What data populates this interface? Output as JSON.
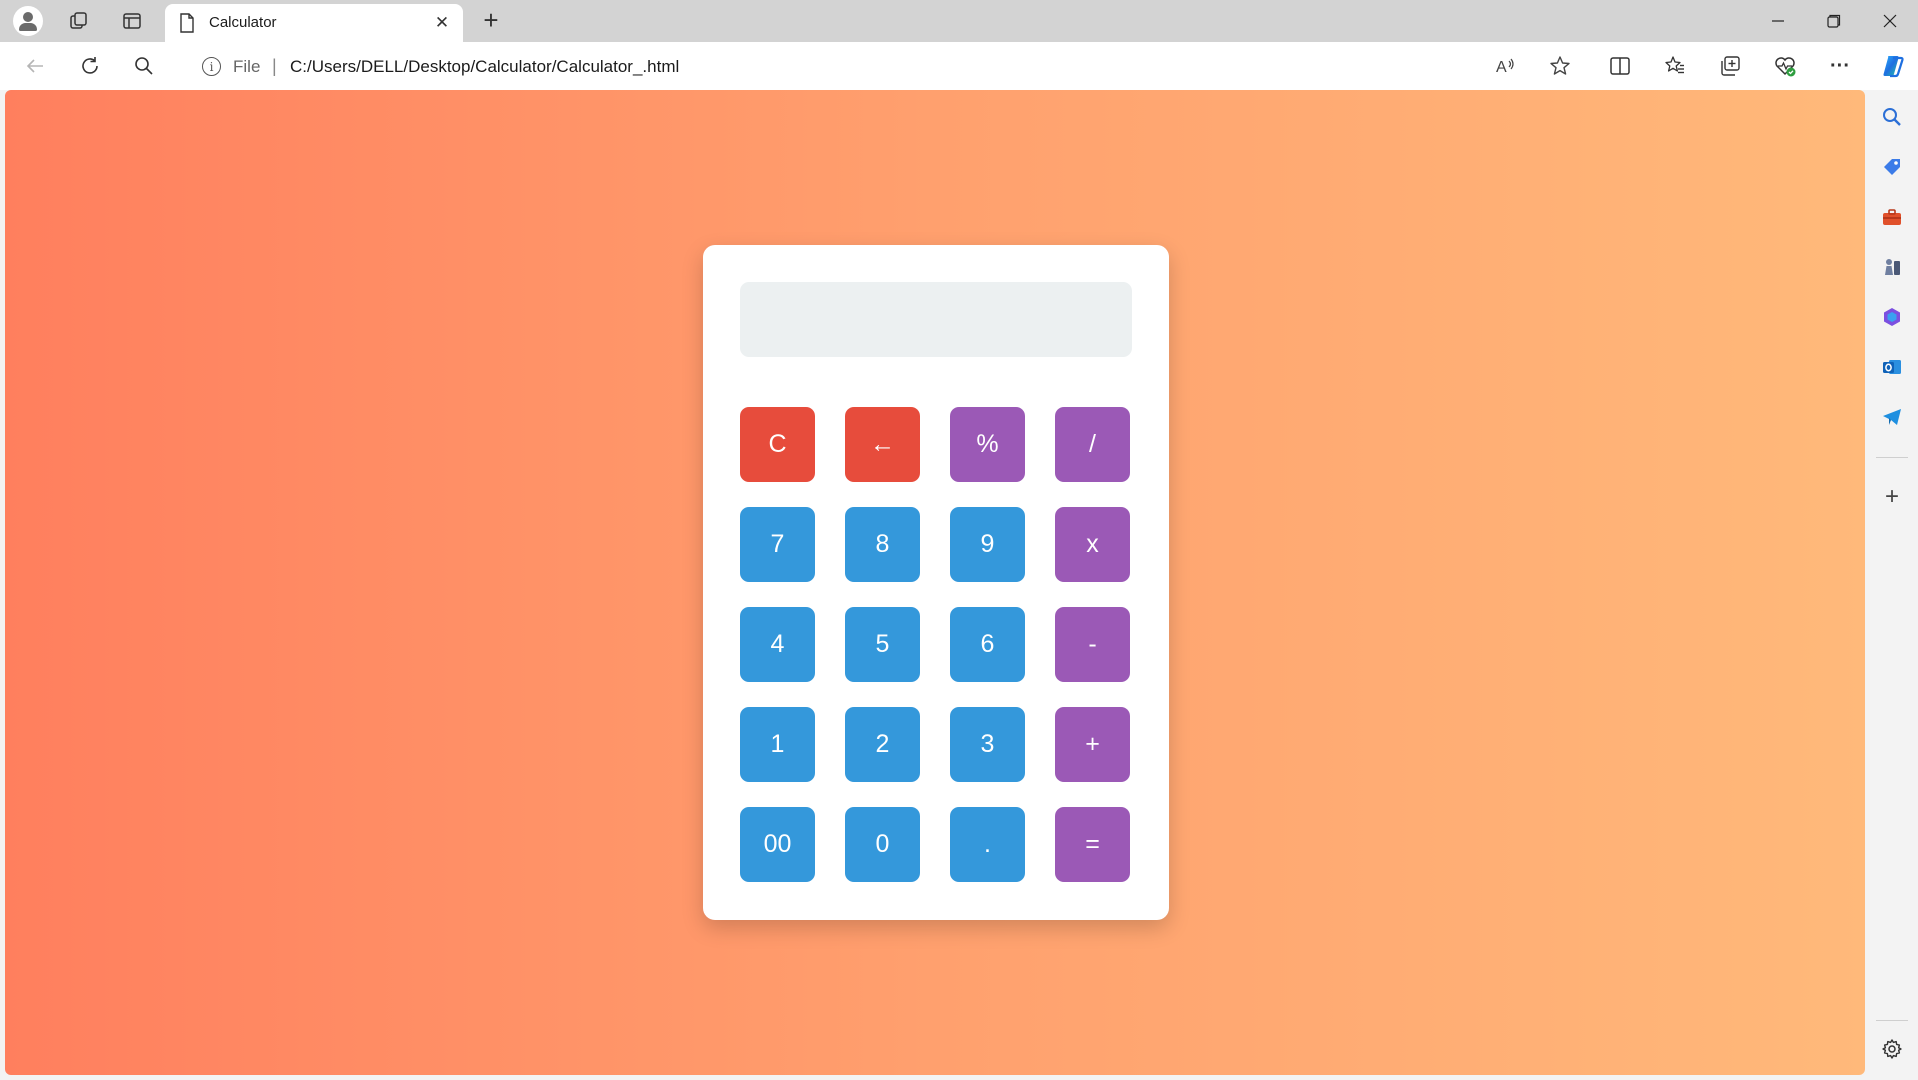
{
  "browser": {
    "tab_title": "Calculator",
    "tab_close": "✕",
    "new_tab": "+",
    "scheme_label": "File",
    "separator": "|",
    "url": "C:/Users/DELL/Desktop/Calculator/Calculator_.html",
    "window_controls": {
      "minimize": "—",
      "restore": "❐",
      "close": "✕"
    },
    "more_menu": "···"
  },
  "calculator": {
    "display_value": "",
    "keys": [
      {
        "label": "C",
        "kind": "clear",
        "name": "clear-button"
      },
      {
        "label": "←",
        "kind": "clear",
        "name": "backspace-button"
      },
      {
        "label": "%",
        "kind": "op",
        "name": "percent-button"
      },
      {
        "label": "/",
        "kind": "op",
        "name": "divide-button"
      },
      {
        "label": "7",
        "kind": "num",
        "name": "digit-7-button"
      },
      {
        "label": "8",
        "kind": "num",
        "name": "digit-8-button"
      },
      {
        "label": "9",
        "kind": "num",
        "name": "digit-9-button"
      },
      {
        "label": "x",
        "kind": "op",
        "name": "multiply-button"
      },
      {
        "label": "4",
        "kind": "num",
        "name": "digit-4-button"
      },
      {
        "label": "5",
        "kind": "num",
        "name": "digit-5-button"
      },
      {
        "label": "6",
        "kind": "num",
        "name": "digit-6-button"
      },
      {
        "label": "-",
        "kind": "op",
        "name": "subtract-button"
      },
      {
        "label": "1",
        "kind": "num",
        "name": "digit-1-button"
      },
      {
        "label": "2",
        "kind": "num",
        "name": "digit-2-button"
      },
      {
        "label": "3",
        "kind": "num",
        "name": "digit-3-button"
      },
      {
        "label": "+",
        "kind": "op",
        "name": "add-button"
      },
      {
        "label": "00",
        "kind": "num",
        "name": "double-zero-button"
      },
      {
        "label": "0",
        "kind": "num",
        "name": "digit-0-button"
      },
      {
        "label": ".",
        "kind": "num",
        "name": "decimal-button"
      },
      {
        "label": "=",
        "kind": "op",
        "name": "equals-button"
      }
    ]
  },
  "colors": {
    "clear": "#e74c3c",
    "operator": "#9b59b6",
    "number": "#3498db",
    "display_bg": "#ecf0f1",
    "gradient_start": "#ff7f5e",
    "gradient_end": "#ffb97a"
  },
  "sidebar": {
    "icons": [
      "search-icon",
      "shopping-tag-icon",
      "tools-icon",
      "games-icon",
      "microsoft-365-icon",
      "outlook-icon",
      "telegram-icon",
      "add-icon",
      "settings-icon"
    ],
    "add_label": "+"
  }
}
